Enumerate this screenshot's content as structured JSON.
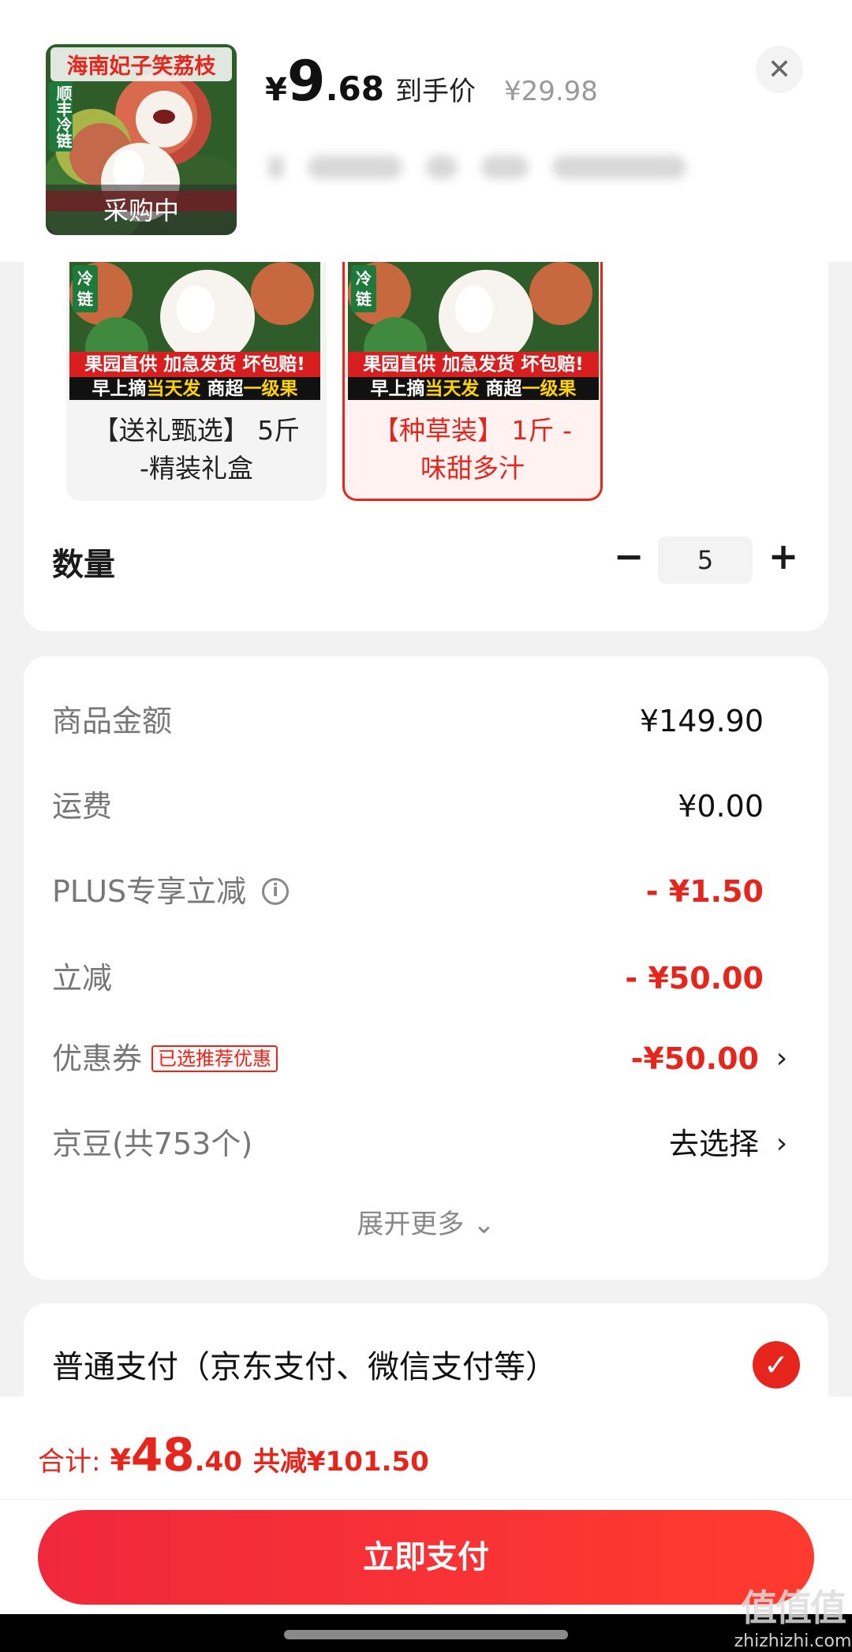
{
  "product": {
    "thumb_title": "海南妃子笑荔枝",
    "thumb_badge": "顺丰冷链",
    "thumb_status": "采购中",
    "price_symbol": "¥",
    "price_int": "9",
    "price_dec": ".68",
    "price_tag": "到手价",
    "original_price": "¥29.98",
    "close_icon": "close-icon"
  },
  "variants": [
    {
      "banner1": "果园直供 加急发货 坏包赔!",
      "banner2_a": "早上摘",
      "banner2_hl": "当天发",
      "banner2_b": " 商超",
      "banner2_hl2": "一级果",
      "badge": "冷链",
      "label": "【送礼甄选】 5斤 -精装礼盒",
      "selected": false
    },
    {
      "banner1": "果园直供 加急发货 坏包赔!",
      "banner2_a": "早上摘",
      "banner2_hl": "当天发",
      "banner2_b": " 商超",
      "banner2_hl2": "一级果",
      "badge": "冷链",
      "label": "【种草装】 1斤 -味甜多汁",
      "selected": true
    }
  ],
  "quantity": {
    "label": "数量",
    "minus": "−",
    "value": "5",
    "plus": "+"
  },
  "fees": {
    "goods_label": "商品金额",
    "goods_value": "¥149.90",
    "shipping_label": "运费",
    "shipping_value": "¥0.00",
    "plus_label": "PLUS专享立减",
    "plus_value": "- ¥1.50",
    "instant_label": "立减",
    "instant_value": "- ¥50.00",
    "coupon_label": "优惠券",
    "coupon_tag": "已选推荐优惠",
    "coupon_value": "-¥50.00",
    "jingdou_label": "京豆(共753个)",
    "jingdou_value": "去选择",
    "expand": "展开更多"
  },
  "payment": {
    "method": "普通支付（京东支付、微信支付等）",
    "selected": true
  },
  "total": {
    "label": "合计:",
    "yen": "¥",
    "int": "48",
    "dec": ".40",
    "saved": "共减¥101.50"
  },
  "actions": {
    "pay_label": "立即支付"
  },
  "watermark": {
    "big": "值值值",
    "small": "zhizhizhi.com"
  },
  "colors": {
    "accent": "#e6261c",
    "background": "#f2f2f2"
  }
}
